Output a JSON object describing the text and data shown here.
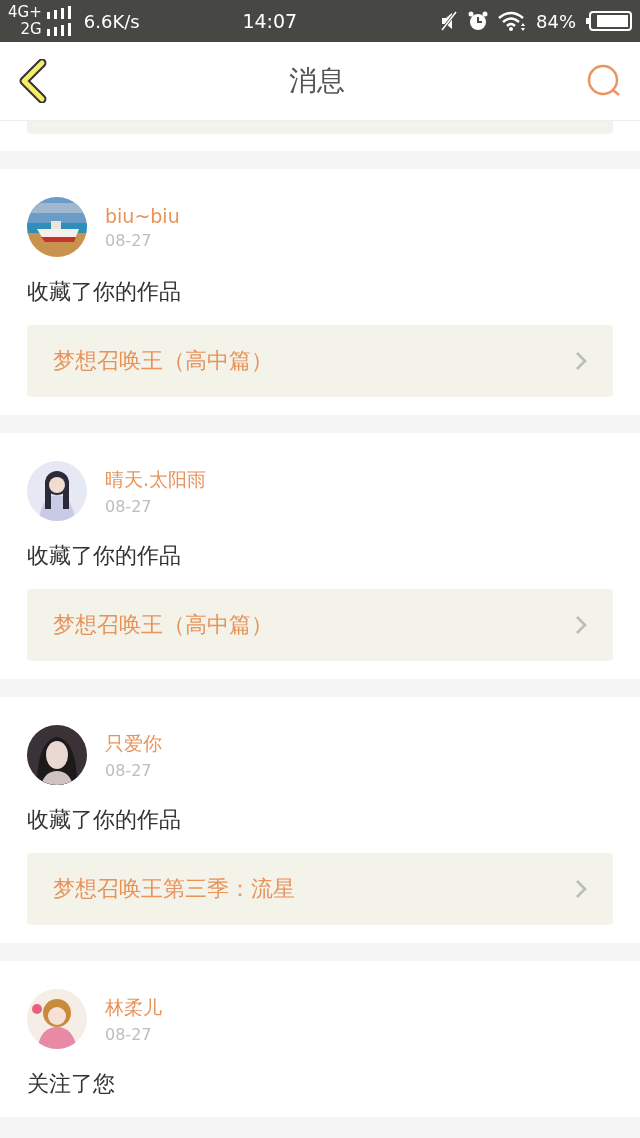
{
  "status_bar": {
    "network_top": "4G+",
    "network_bottom": "2G",
    "speed": "6.6K/s",
    "time": "14:07",
    "battery": "84%"
  },
  "header": {
    "title": "消息"
  },
  "messages": [
    {
      "user": "biu~biu",
      "date": "08-27",
      "action": "收藏了你的作品",
      "work": "梦想召唤王（高中篇）"
    },
    {
      "user": "晴天.太阳雨",
      "date": "08-27",
      "action": "收藏了你的作品",
      "work": "梦想召唤王（高中篇）"
    },
    {
      "user": "只爱你",
      "date": "08-27",
      "action": "收藏了你的作品",
      "work": "梦想召唤王第三季：流星"
    },
    {
      "user": "林柔儿",
      "date": "08-27",
      "action": "关注了您"
    }
  ]
}
